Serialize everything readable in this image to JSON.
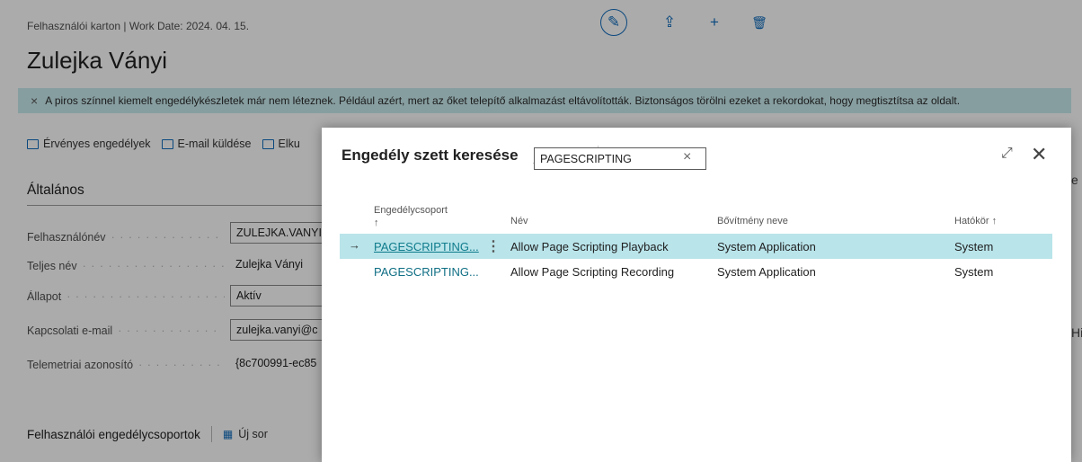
{
  "window": {
    "breadcrumb": "Felhasználói karton | Work Date: 2024. 04. 15.",
    "title": "Zulejka Ványi"
  },
  "top_actions": [
    {
      "icon": "edit-pencil-icon",
      "glyph": "✎"
    },
    {
      "icon": "share-icon",
      "glyph": "⇪"
    },
    {
      "icon": "plus-icon",
      "glyph": "+"
    },
    {
      "icon": "delete-icon",
      "glyph": "🗑"
    }
  ],
  "notice": {
    "close_glyph": "×",
    "text": "A piros színnel kiemelt engedélykészletek már nem léteznek. Például azért, mert az őket telepítő alkalmazást eltávolították. Biztonságos törölni ezeket a rekordokat, hogy megtisztítsa az oldalt."
  },
  "actionbar": {
    "effective_permissions": "Érvényes engedélyek",
    "send_email": "E-mail küldése",
    "third": "Elku"
  },
  "general": {
    "title": "Általános",
    "fields": [
      {
        "label": "Felhasználónév",
        "value": "ZULEJKA.VANYI"
      },
      {
        "label": "Teljes név",
        "value": "Zulejka Ványi"
      },
      {
        "label": "Állapot",
        "value": "Aktív"
      },
      {
        "label": "Kapcsolati e-mail",
        "value": "zulejka.vanyi@c"
      },
      {
        "label": "Telemetriai azonosító",
        "value": "{8c700991-ec85"
      }
    ]
  },
  "permission_groups": {
    "title": "Felhasználói engedélycsoportok",
    "new_row": "Új sor"
  },
  "right_fragments": [
    "e",
    "Hi"
  ],
  "modal": {
    "title": "Engedély szett keresése",
    "search_value": "PAGESCRIPTING",
    "expand_glyph": "⤢",
    "close_glyph": "✕",
    "columns": {
      "group": "Engedélycsoport",
      "group_sort": "↑",
      "name": "Név",
      "extension": "Bővítmény neve",
      "scope": "Hatókör ↑"
    },
    "rows": [
      {
        "group": "PAGESCRIPTING...",
        "name": "Allow Page Scripting Playback",
        "extension": "System Application",
        "scope": "System",
        "selected": true
      },
      {
        "group": "PAGESCRIPTING...",
        "name": "Allow Page Scripting Recording",
        "extension": "System Application",
        "scope": "System",
        "selected": false
      }
    ]
  },
  "colors": {
    "accent": "#0f6cbd",
    "notice_bg": "#c9ecef",
    "selected_row": "#b9e4ea",
    "link": "#0f7c8c"
  }
}
